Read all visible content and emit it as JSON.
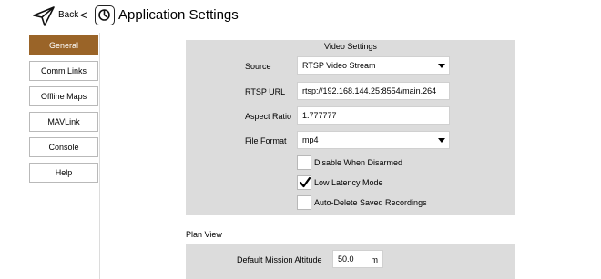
{
  "header": {
    "back_label": "Back",
    "chevron": "<",
    "title": "Application Settings",
    "back_icon": "paper-plane-icon",
    "app_icon": "qgc-logo-icon"
  },
  "sidebar": {
    "items": [
      {
        "label": "General",
        "active": true
      },
      {
        "label": "Comm Links",
        "active": false
      },
      {
        "label": "Offline Maps",
        "active": false
      },
      {
        "label": "MAVLink",
        "active": false
      },
      {
        "label": "Console",
        "active": false
      },
      {
        "label": "Help",
        "active": false
      }
    ],
    "accent_color": "#9a6428"
  },
  "video_settings": {
    "title": "Video Settings",
    "source_label": "Source",
    "source_value": "RTSP Video Stream",
    "rtsp_label": "RTSP URL",
    "rtsp_value": "rtsp://192.168.144.25:8554/main.264",
    "aspect_label": "Aspect Ratio",
    "aspect_value": "1.777777",
    "format_label": "File Format",
    "format_value": "mp4",
    "checkboxes": [
      {
        "label": "Disable When Disarmed",
        "checked": false
      },
      {
        "label": "Low Latency Mode",
        "checked": true
      },
      {
        "label": "Auto-Delete Saved Recordings",
        "checked": false
      }
    ]
  },
  "plan_view": {
    "title": "Plan View",
    "altitude_label": "Default Mission Altitude",
    "altitude_value": "50.0",
    "altitude_unit": "m"
  }
}
